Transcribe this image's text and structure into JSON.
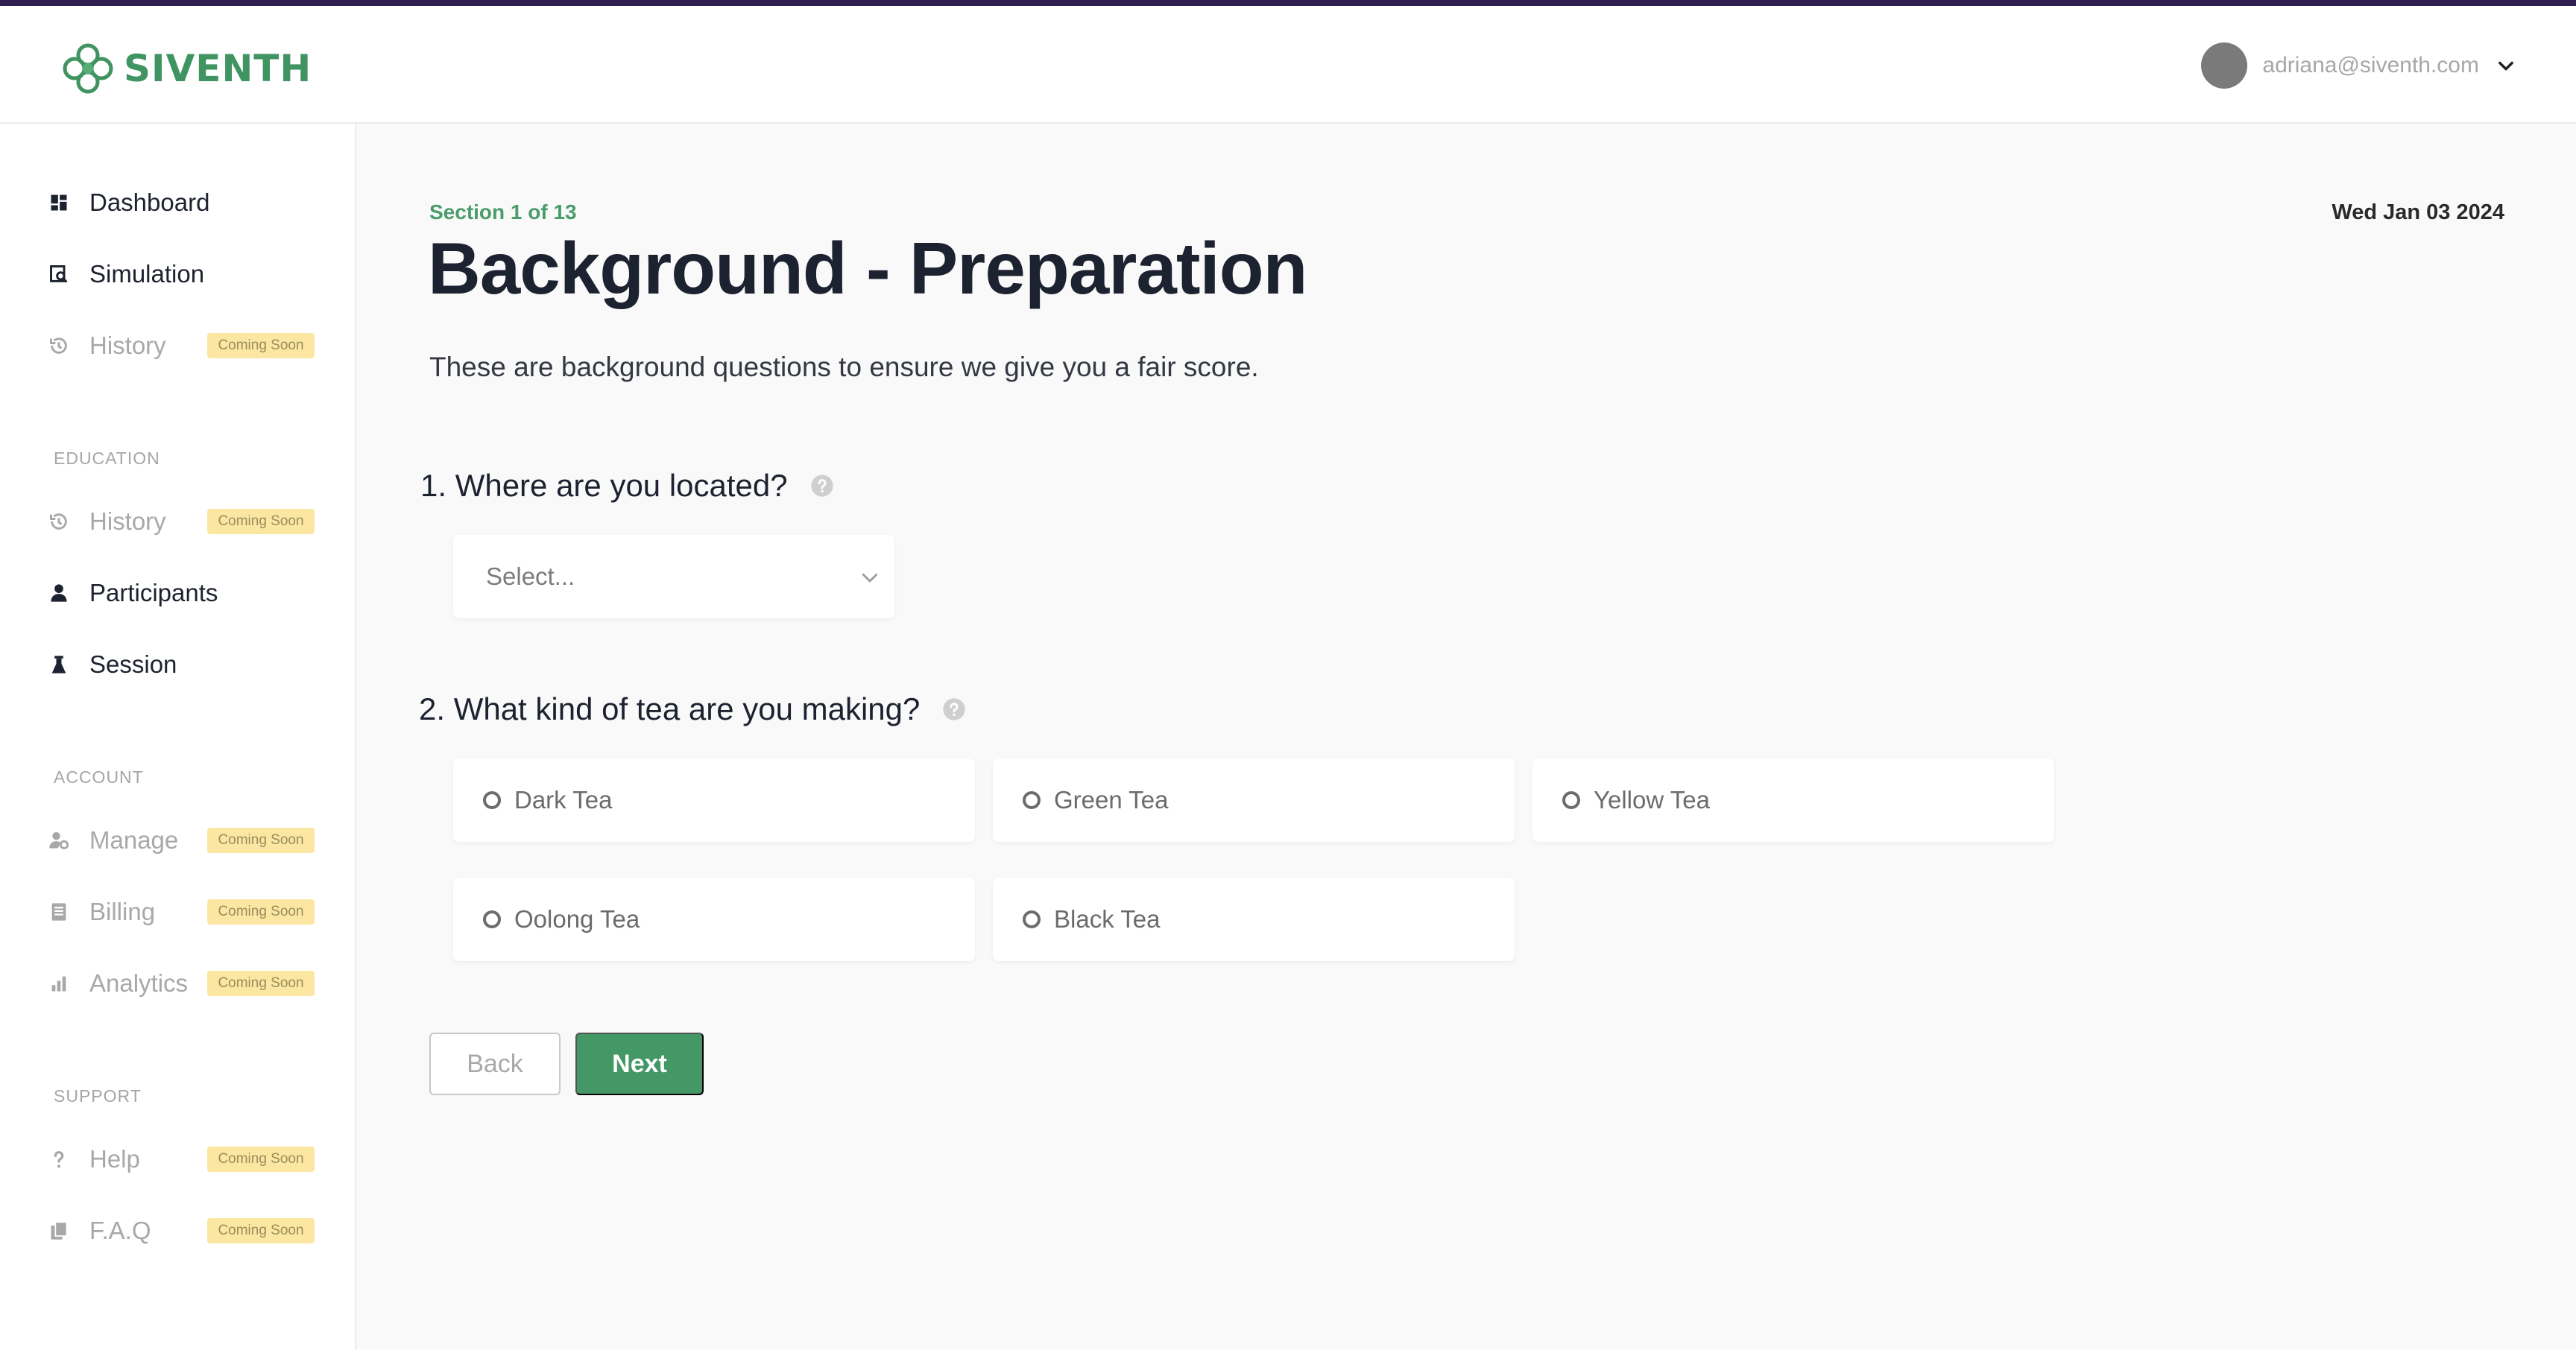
{
  "brand": {
    "logo_text": "SIVENTH",
    "logo_icon": "celtic-knot-logo",
    "colors": {
      "primary": "#449866",
      "accent_stripe": "#2e1f4e",
      "badge": "#fbe7a2"
    }
  },
  "user": {
    "email": "adriana@siventh.com",
    "menu_icon": "chevron-down-icon"
  },
  "sidebar": {
    "items": [
      {
        "label": "Dashboard",
        "icon": "dashboard-icon",
        "disabled": false
      },
      {
        "label": "Simulation",
        "icon": "simulation-icon",
        "disabled": false
      },
      {
        "label": "History",
        "icon": "history-icon",
        "disabled": true,
        "badge": "Coming Soon"
      }
    ],
    "sections": [
      {
        "label": "EDUCATION",
        "items": [
          {
            "label": "History",
            "icon": "history-icon",
            "disabled": true,
            "badge": "Coming Soon"
          },
          {
            "label": "Participants",
            "icon": "person-icon",
            "disabled": false
          },
          {
            "label": "Session",
            "icon": "flask-icon",
            "disabled": false
          }
        ]
      },
      {
        "label": "ACCOUNT",
        "items": [
          {
            "label": "Manage",
            "icon": "manage-user-icon",
            "disabled": true,
            "badge": "Coming Soon"
          },
          {
            "label": "Billing",
            "icon": "billing-icon",
            "disabled": true,
            "badge": "Coming Soon"
          },
          {
            "label": "Analytics",
            "icon": "bar-chart-icon",
            "disabled": true,
            "badge": "Coming Soon"
          }
        ]
      },
      {
        "label": "SUPPORT",
        "items": [
          {
            "label": "Help",
            "icon": "question-icon",
            "disabled": true,
            "badge": "Coming Soon"
          },
          {
            "label": "F.A.Q",
            "icon": "docs-icon",
            "disabled": true,
            "badge": "Coming Soon"
          }
        ]
      }
    ]
  },
  "main": {
    "section_count": "Section 1 of 13",
    "date": "Wed Jan 03 2024",
    "title": "Background - Preparation",
    "subtitle": "These are background questions to ensure we give you a fair score.",
    "questions": [
      {
        "text": "1. Where are you located?",
        "help_icon": "help-circle-icon",
        "type": "select",
        "placeholder": "Select..."
      },
      {
        "text": "2. What kind of tea are you making?",
        "help_icon": "help-circle-icon",
        "type": "radio",
        "options": [
          "Dark Tea",
          "Green Tea",
          "Yellow Tea",
          "Oolong Tea",
          "Black Tea"
        ]
      }
    ],
    "buttons": {
      "back": "Back",
      "next": "Next"
    }
  }
}
